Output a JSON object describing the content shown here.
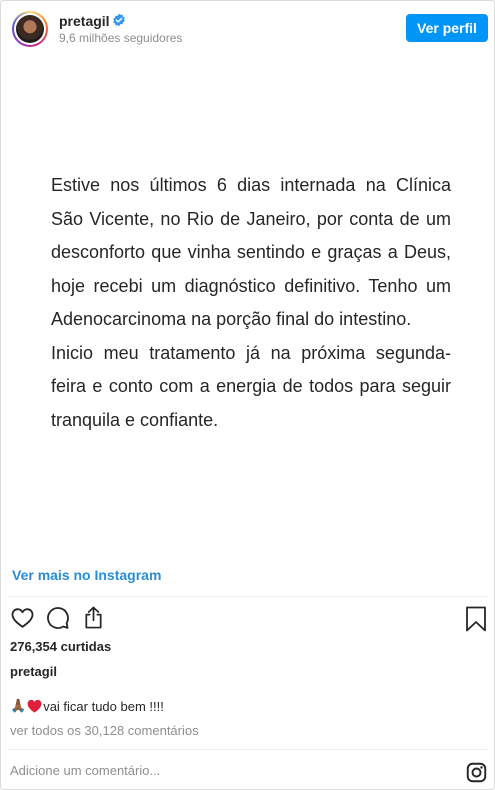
{
  "header": {
    "username": "pretagil",
    "followers": "9,6 milhões seguidores",
    "view_profile_label": "Ver perfil"
  },
  "post": {
    "paragraphs": [
      "Estive nos últimos 6 dias internada na Clínica São Vicente, no Rio de Janeiro, por conta de um desconforto que vinha sentindo e graças a Deus, hoje recebi um diagnóstico definitivo. Tenho um Adenocarcinoma na porção final do intestino.",
      "Inicio meu tratamento já na próxima segunda-feira e conto com a energia de todos para seguir tranquila e confiante."
    ]
  },
  "more_link": "Ver mais no Instagram",
  "likes": "276,354 curtidas",
  "caption": {
    "owner": "pretagil",
    "emoji": "🙏🏾",
    "text": "vai ficar tudo bem !!!!"
  },
  "comments_link": "ver todos os 30,128 comentários",
  "add_comment_placeholder": "Adicione um comentário...",
  "colors": {
    "accent_button": "#0095f6",
    "link": "#2b8dd6",
    "heart": "#e0203b",
    "verified_badge": "#3897f0"
  },
  "icons": [
    "verified-icon",
    "like-icon",
    "comment-icon",
    "share-icon",
    "save-icon",
    "heart-emoji-icon",
    "instagram-logo-icon"
  ]
}
